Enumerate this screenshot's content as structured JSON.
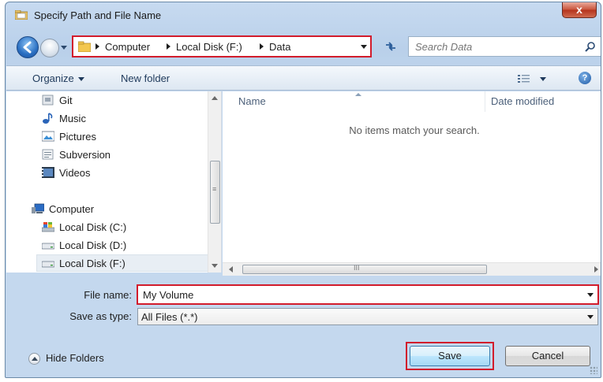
{
  "window": {
    "title": "Specify Path and File Name",
    "close_label": "x"
  },
  "address": {
    "crumbs": [
      "Computer",
      "Local Disk (F:)",
      "Data"
    ]
  },
  "search": {
    "placeholder": "Search Data"
  },
  "toolbar": {
    "organize_label": "Organize",
    "new_folder_label": "New folder",
    "help_label": "?"
  },
  "nav": {
    "items": [
      {
        "label": "Git",
        "icon": "git-folder-icon"
      },
      {
        "label": "Music",
        "icon": "music-icon"
      },
      {
        "label": "Pictures",
        "icon": "pictures-icon"
      },
      {
        "label": "Subversion",
        "icon": "document-folder-icon"
      },
      {
        "label": "Videos",
        "icon": "video-icon"
      },
      {
        "label": "Computer",
        "icon": "computer-icon"
      },
      {
        "label": "Local Disk (C:)",
        "icon": "system-drive-icon"
      },
      {
        "label": "Local Disk (D:)",
        "icon": "drive-icon"
      },
      {
        "label": "Local Disk (F:)",
        "icon": "drive-icon",
        "selected": true
      }
    ]
  },
  "file_list": {
    "columns": [
      "Name",
      "Date modified"
    ],
    "empty_message": "No items match your search.",
    "hscroll_grip": "III",
    "vscroll_grip": "≡"
  },
  "form": {
    "file_name_label": "File name:",
    "file_name_value": "My Volume",
    "save_type_label": "Save as type:",
    "save_type_value": "All Files (*.*)"
  },
  "footer": {
    "hide_folders_label": "Hide Folders",
    "save_label": "Save",
    "cancel_label": "Cancel"
  },
  "colors": {
    "highlight": "#d21c2c",
    "chrome": "#c4d8ee",
    "link": "#1e395b"
  }
}
